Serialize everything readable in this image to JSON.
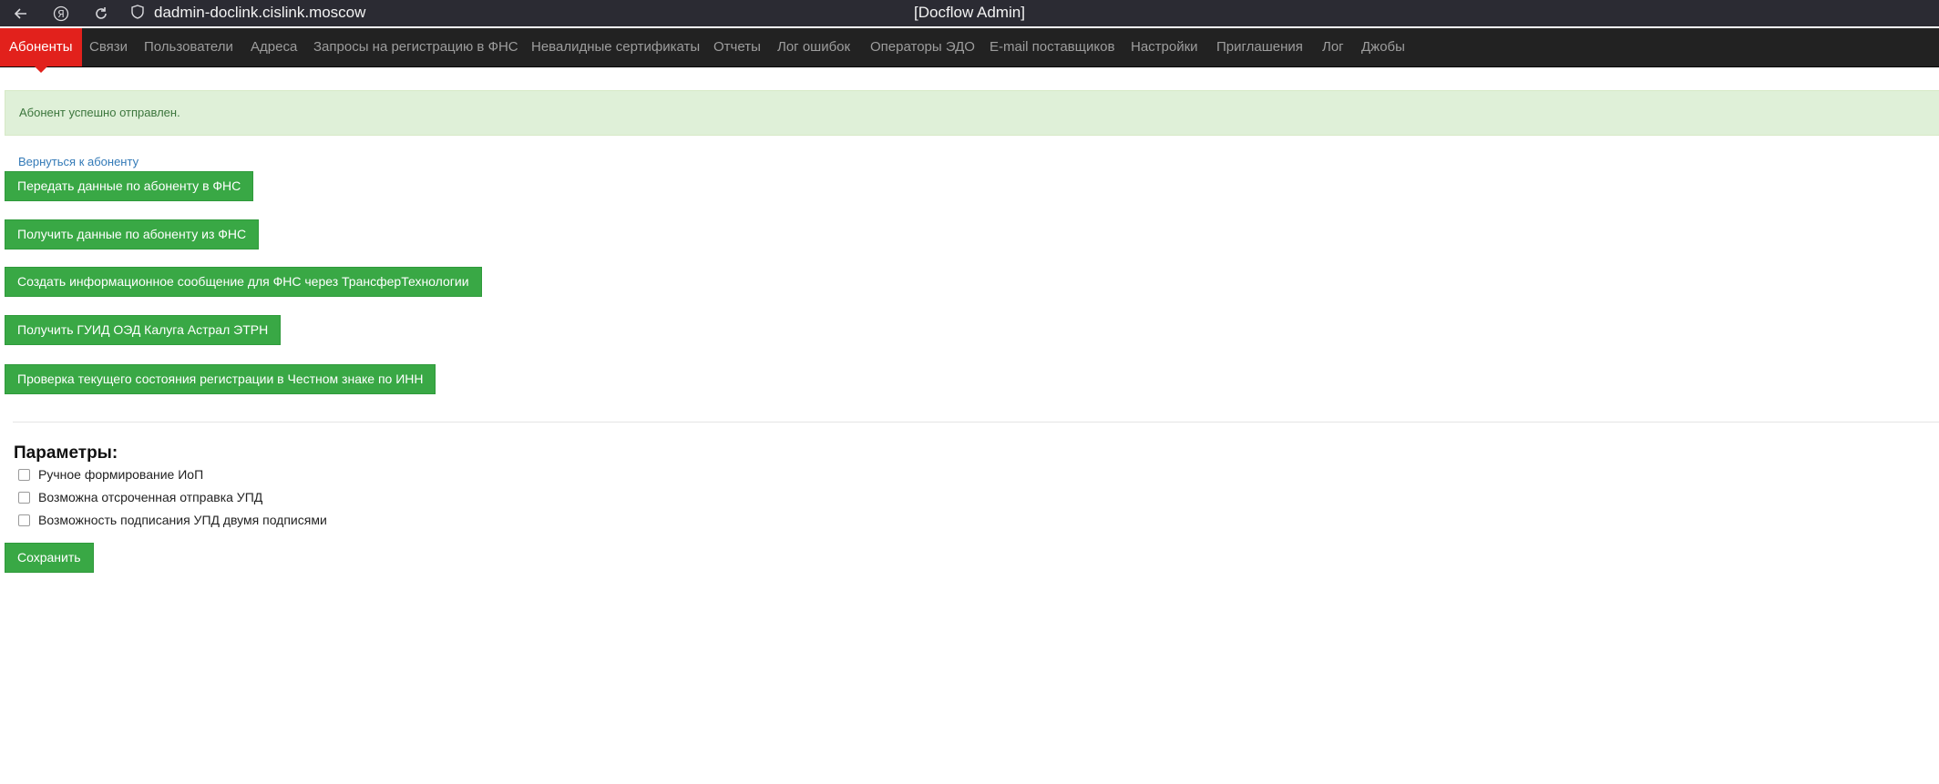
{
  "browser": {
    "url": "dadmin-doclink.cislink.moscow",
    "page_title": "[Docflow Admin]"
  },
  "navbar": {
    "items": [
      {
        "label": "Абоненты",
        "active": true
      },
      {
        "label": "Связи"
      },
      {
        "label": "Пользователи"
      },
      {
        "label": "Адреса"
      },
      {
        "label": "Запросы на регистрацию в ФНС"
      },
      {
        "label": "Невалидные сертификаты"
      },
      {
        "label": "Отчеты"
      },
      {
        "label": "Лог ошибок"
      },
      {
        "label": "Операторы ЭДО"
      },
      {
        "label": "E-mail поставщиков"
      },
      {
        "label": "Настройки"
      },
      {
        "label": "Приглашения"
      },
      {
        "label": "Лог"
      },
      {
        "label": "Джобы"
      }
    ]
  },
  "alert": {
    "message": "Абонент успешно отправлен."
  },
  "back_link": "Вернуться к абоненту",
  "actions": [
    "Передать данные по абоненту в ФНС",
    "Получить данные по абоненту из ФНС",
    "Создать информационное сообщение для ФНС через ТрансферТехнологии",
    "Получить ГУИД ОЭД Калуга Астрал ЭТРН",
    "Проверка текущего состояния регистрации в Честном знаке по ИНН"
  ],
  "params": {
    "heading": "Параметры:",
    "options": [
      {
        "label": "Ручное формирование ИоП",
        "checked": false
      },
      {
        "label": "Возможна отсроченная отправка УПД",
        "checked": false
      },
      {
        "label": "Возможность подписания УПД двумя подписями",
        "checked": false
      }
    ],
    "save_label": "Сохранить"
  },
  "colors": {
    "navbar_bg": "#222222",
    "active_tab": "#e2211c",
    "button_green": "#39a845",
    "alert_bg": "#dff0d8",
    "link": "#337ab7"
  }
}
